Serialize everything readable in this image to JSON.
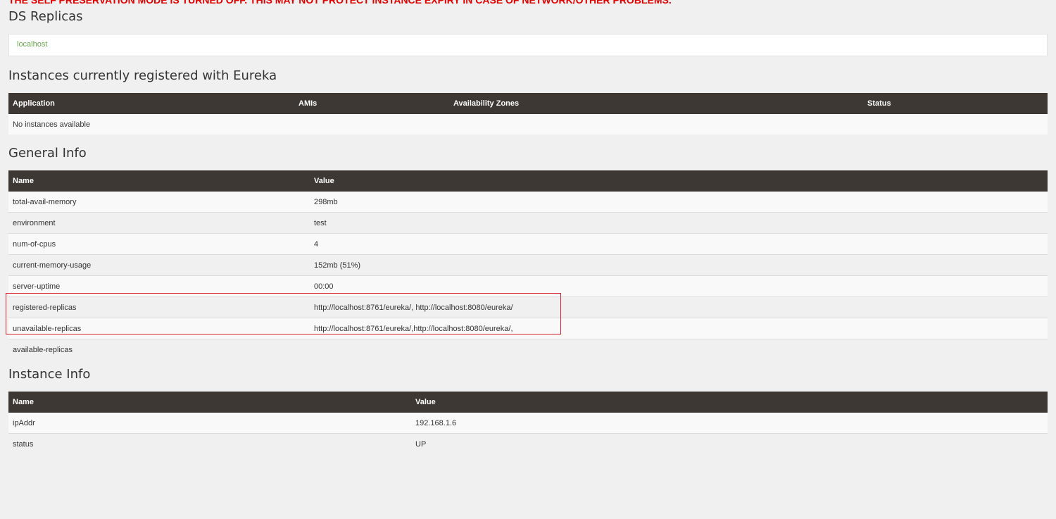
{
  "warning_text": "THE SELF PRESERVATION MODE IS TURNED OFF. THIS MAY NOT PROTECT INSTANCE EXPIRY IN CASE OF NETWORK/OTHER PROBLEMS.",
  "ds_replicas": {
    "title": "DS Replicas",
    "link": "localhost"
  },
  "instances": {
    "title": "Instances currently registered with Eureka",
    "headers": [
      "Application",
      "AMIs",
      "Availability Zones",
      "Status"
    ],
    "empty_message": "No instances available"
  },
  "general_info": {
    "title": "General Info",
    "headers": [
      "Name",
      "Value"
    ],
    "rows": [
      {
        "name": "total-avail-memory",
        "value": "298mb"
      },
      {
        "name": "environment",
        "value": "test"
      },
      {
        "name": "num-of-cpus",
        "value": "4"
      },
      {
        "name": "current-memory-usage",
        "value": "152mb (51%)"
      },
      {
        "name": "server-uptime",
        "value": "00:00"
      },
      {
        "name": "registered-replicas",
        "value": "http://localhost:8761/eureka/, http://localhost:8080/eureka/"
      },
      {
        "name": "unavailable-replicas",
        "value": "http://localhost:8761/eureka/,http://localhost:8080/eureka/,"
      },
      {
        "name": "available-replicas",
        "value": ""
      }
    ]
  },
  "instance_info": {
    "title": "Instance Info",
    "headers": [
      "Name",
      "Value"
    ],
    "rows": [
      {
        "name": "ipAddr",
        "value": "192.168.1.6"
      },
      {
        "name": "status",
        "value": "UP"
      }
    ]
  },
  "colors": {
    "header_bg": "#3d3833",
    "link": "#6aa84f",
    "warning": "#e00000",
    "highlight": "#d9232e"
  }
}
